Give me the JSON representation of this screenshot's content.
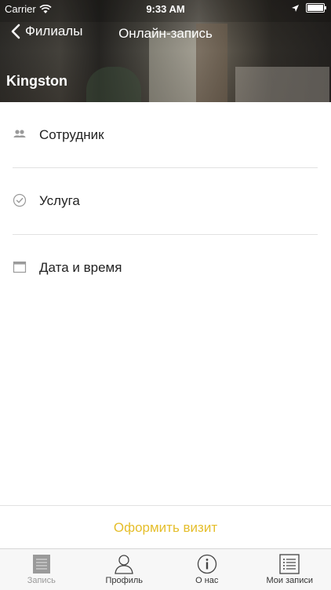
{
  "status_bar": {
    "carrier": "Carrier",
    "time": "9:33 AM"
  },
  "nav": {
    "back_label": "Филиалы",
    "title": "Онлайн-запись"
  },
  "branch_name": "Kingston",
  "list": [
    {
      "label": "Сотрудник",
      "icon": "people-icon"
    },
    {
      "label": "Услуга",
      "icon": "check-circle-icon"
    },
    {
      "label": "Дата и время",
      "icon": "calendar-icon"
    }
  ],
  "cta_label": "Оформить визит",
  "tabs": [
    {
      "label": "Запись",
      "icon": "document-icon",
      "state": "inactive"
    },
    {
      "label": "Профиль",
      "icon": "person-icon",
      "state": "active"
    },
    {
      "label": "О нас",
      "icon": "info-icon",
      "state": "active"
    },
    {
      "label": "Мои записи",
      "icon": "list-icon",
      "state": "active"
    }
  ],
  "colors": {
    "accent": "#e5be2b",
    "separator": "#e2e2e2",
    "tab_inactive": "#9a9a9a"
  }
}
